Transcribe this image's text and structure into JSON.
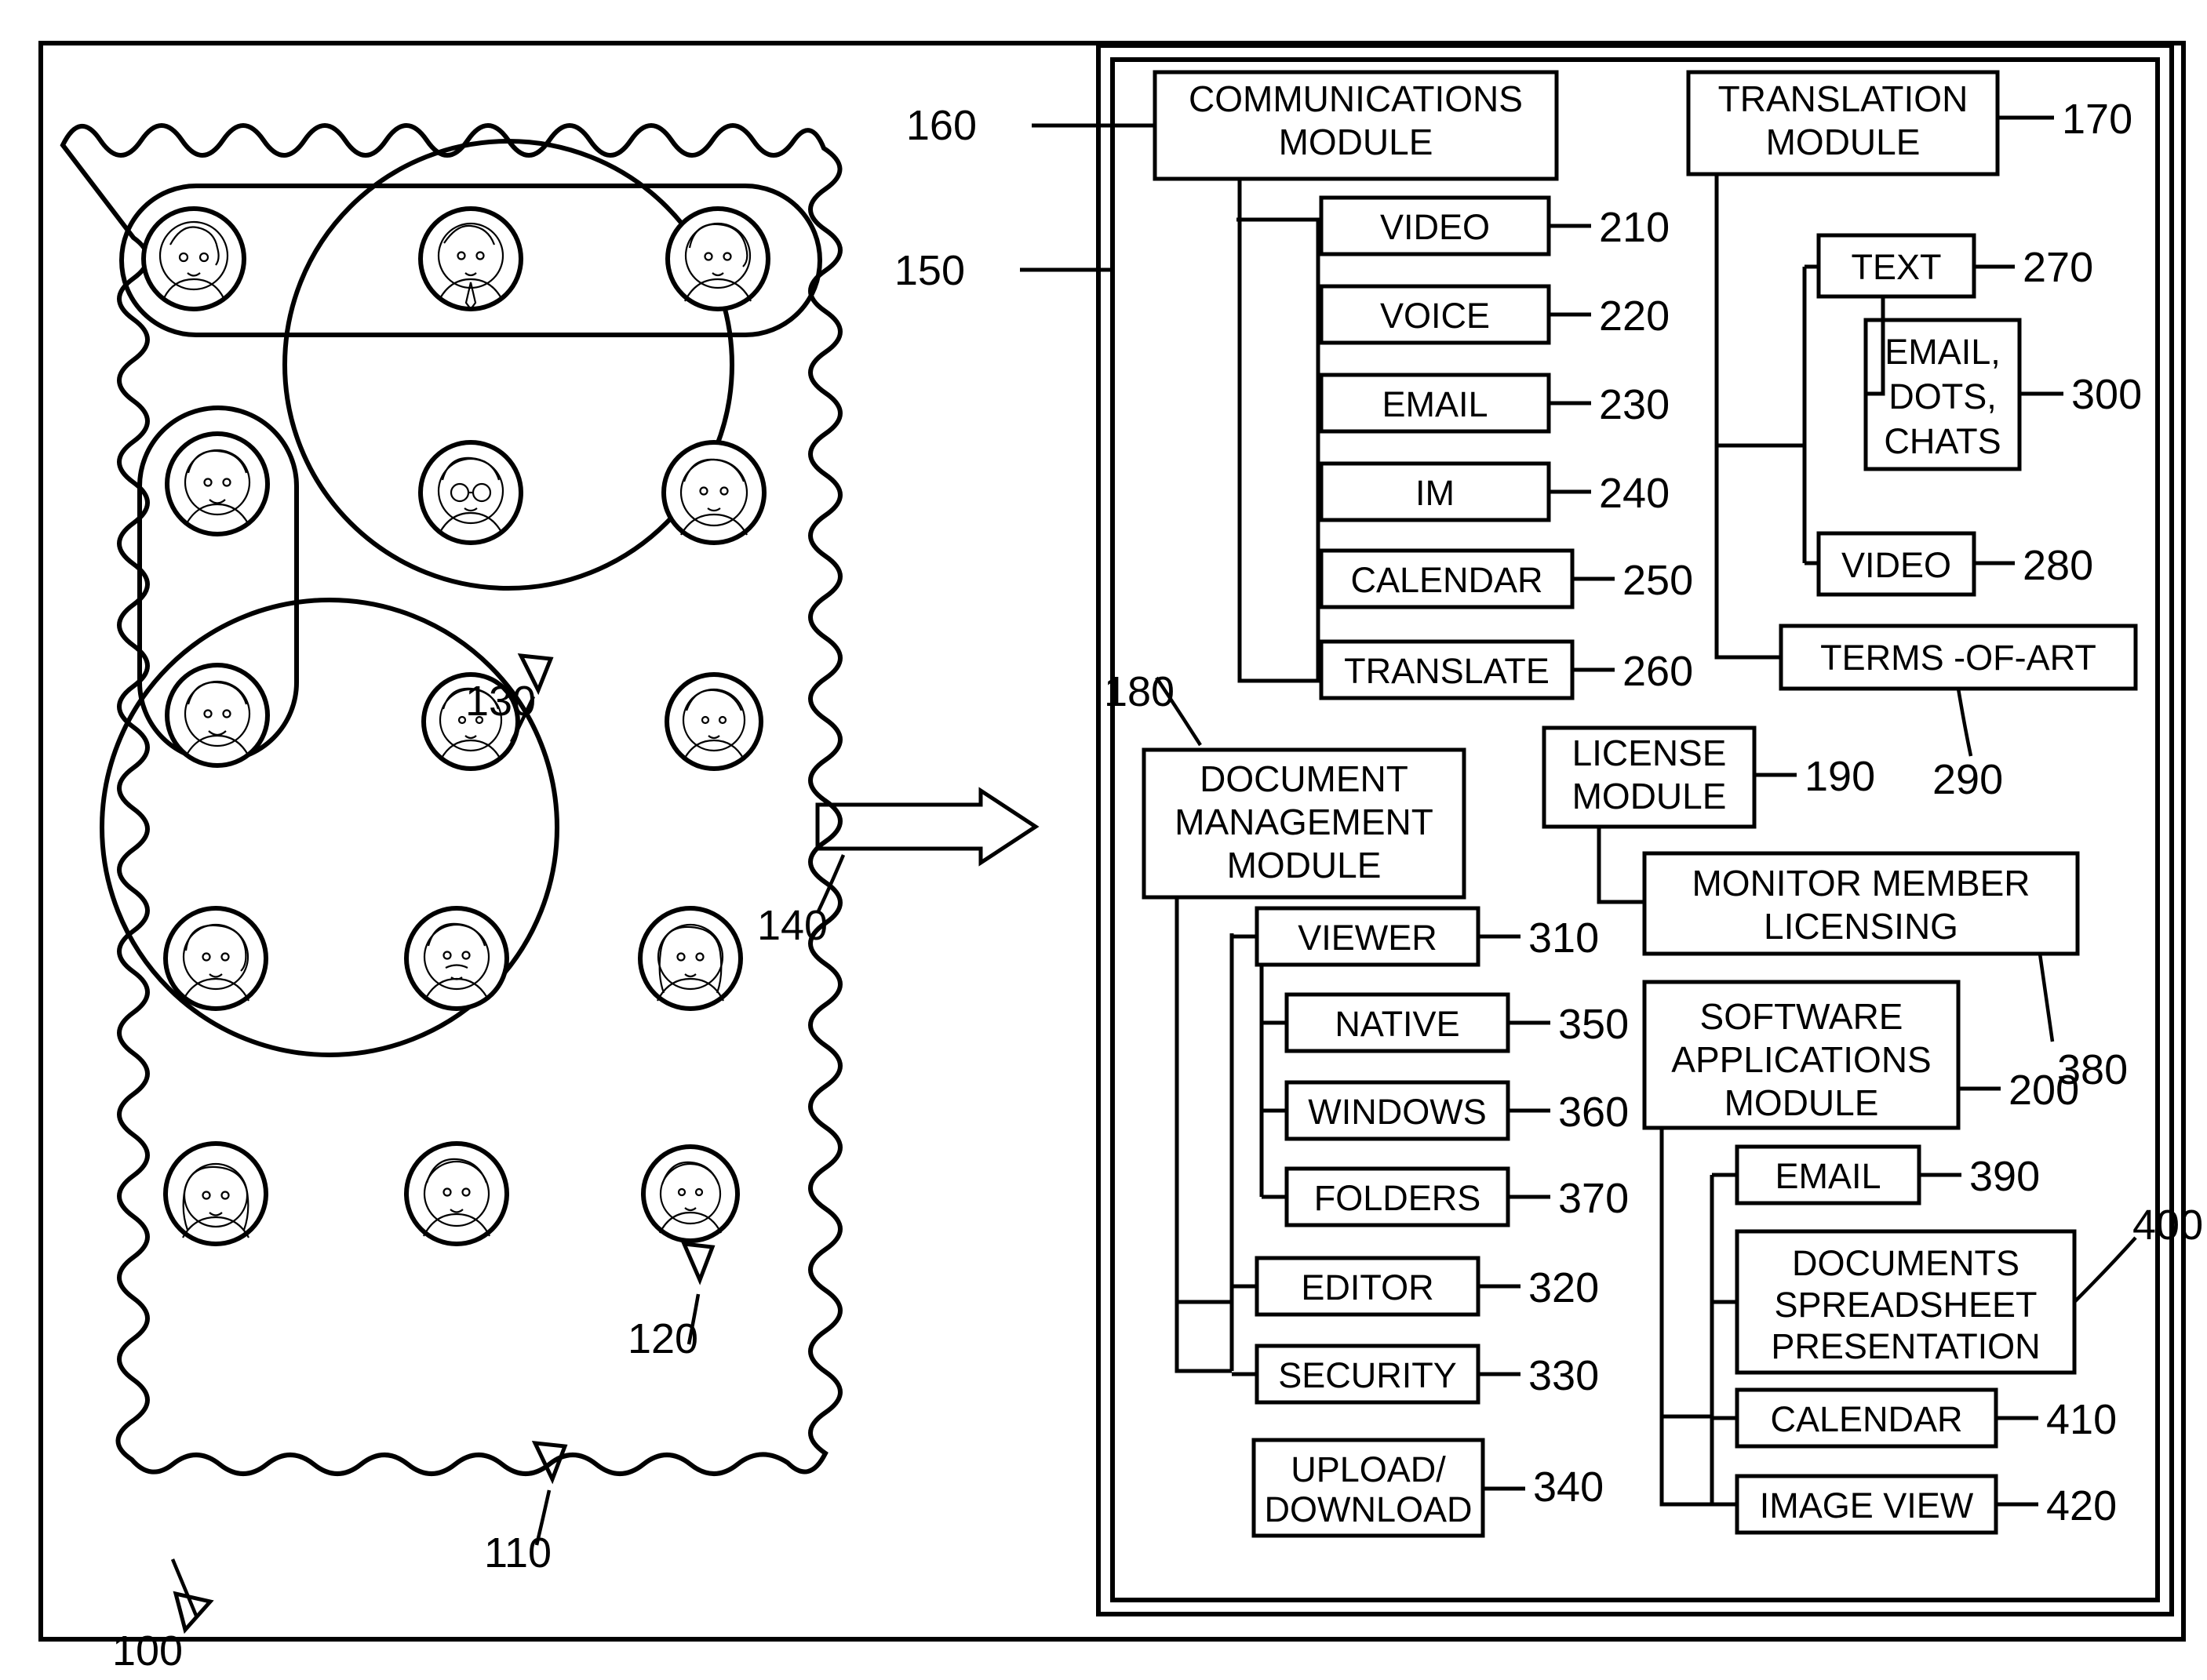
{
  "figure": {
    "title_reference": "100",
    "left_panel_reference": "110",
    "member_reference": "120",
    "group_reference": "130",
    "arrow_reference": "140",
    "platform_reference": "150"
  },
  "reference_numerals": {
    "overall": "100",
    "member_pool": "110",
    "member": "120",
    "group": "130",
    "arrow": "140",
    "platform": "150",
    "communications_module": "160",
    "translation_module": "170",
    "document_management_module": "180",
    "license_module": "190",
    "software_applications_module": "200",
    "video": "210",
    "voice": "220",
    "email": "230",
    "im": "240",
    "calendar": "250",
    "translate": "260",
    "text": "270",
    "translation_video": "280",
    "terms_of_art": "290",
    "email_dots_chats": "300",
    "viewer": "310",
    "editor": "320",
    "security": "330",
    "upload_download": "340",
    "native": "350",
    "windows": "360",
    "folders": "370",
    "monitor_member_licensing": "380",
    "app_email": "390",
    "documents_spreadsheet_presentation": "400",
    "app_calendar": "410",
    "image_view": "420"
  },
  "modules": {
    "communications": {
      "label": "COMMUNICATIONS\nMODULE",
      "line1": "COMMUNICATIONS",
      "line2": "MODULE",
      "ref": "160",
      "children": [
        {
          "label": "VIDEO",
          "ref": "210"
        },
        {
          "label": "VOICE",
          "ref": "220"
        },
        {
          "label": "EMAIL",
          "ref": "230"
        },
        {
          "label": "IM",
          "ref": "240"
        },
        {
          "label": "CALENDAR",
          "ref": "250"
        },
        {
          "label": "TRANSLATE",
          "ref": "260"
        }
      ]
    },
    "translation": {
      "line1": "TRANSLATION",
      "line2": "MODULE",
      "ref": "170",
      "children": [
        {
          "label": "TEXT",
          "ref": "270"
        },
        {
          "label": "VIDEO",
          "ref": "280"
        },
        {
          "label": "TERMS -OF-ART",
          "ref": "290"
        }
      ],
      "text_child": {
        "line1": "EMAIL,",
        "line2": "DOTS,",
        "line3": "CHATS",
        "ref": "300"
      }
    },
    "document_management": {
      "line1": "DOCUMENT",
      "line2": "MANAGEMENT",
      "line3": "MODULE",
      "ref": "180",
      "children": [
        {
          "label": "VIEWER",
          "ref": "310"
        },
        {
          "label": "EDITOR",
          "ref": "320"
        },
        {
          "label": "SECURITY",
          "ref": "330"
        }
      ],
      "viewer_children": [
        {
          "label": "NATIVE",
          "ref": "350"
        },
        {
          "label": "WINDOWS",
          "ref": "360"
        },
        {
          "label": "FOLDERS",
          "ref": "370"
        }
      ],
      "upload_download": {
        "line1": "UPLOAD/",
        "line2": "DOWNLOAD",
        "ref": "340"
      }
    },
    "license": {
      "line1": "LICENSE",
      "line2": "MODULE",
      "ref": "190",
      "child": {
        "line1": "MONITOR MEMBER",
        "line2": "LICENSING",
        "ref": "380"
      }
    },
    "software_applications": {
      "line1": "SOFTWARE",
      "line2": "APPLICATIONS",
      "line3": "MODULE",
      "ref": "200",
      "children": [
        {
          "label": "EMAIL",
          "ref": "390"
        },
        {
          "label": "CALENDAR",
          "ref": "410"
        },
        {
          "label": "IMAGE VIEW",
          "ref": "420"
        }
      ],
      "docs_child": {
        "line1": "DOCUMENTS",
        "line2": "SPREADSHEET",
        "line3": "PRESENTATION",
        "ref": "400"
      }
    }
  },
  "colors": {
    "ink": "#000000",
    "paper": "#ffffff"
  }
}
